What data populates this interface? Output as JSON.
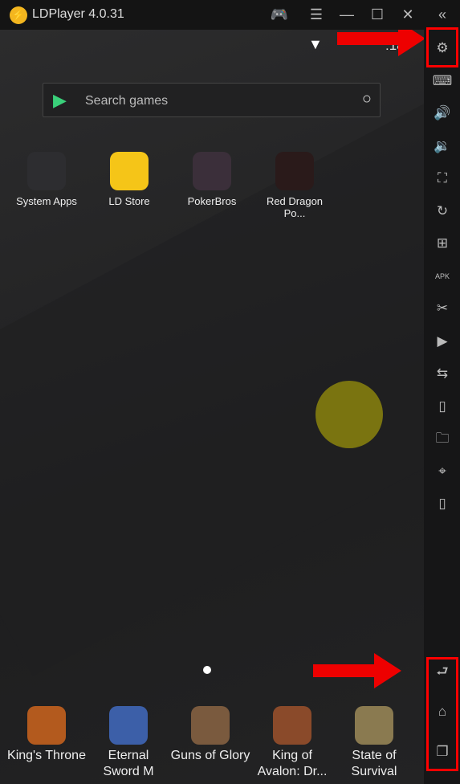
{
  "window": {
    "title": "LDPlayer 4.0.31",
    "controls": [
      "gamepad-icon",
      "menu-icon",
      "minimize-icon",
      "maximize-icon",
      "close-icon",
      "collapse-icon"
    ]
  },
  "status": {
    "time": ":18"
  },
  "search": {
    "placeholder": "Search games"
  },
  "apps": [
    {
      "label": "System Apps",
      "color": "#2d2d30"
    },
    {
      "label": "LD Store",
      "color": "#f5c518"
    },
    {
      "label": "PokerBros",
      "color": "#3b2f3a"
    },
    {
      "label": "Red Dragon Po...",
      "color": "#2a1a1a"
    }
  ],
  "dock": [
    {
      "label": "King's Throne",
      "color": "#b35a1e"
    },
    {
      "label": "Eternal Sword M",
      "color": "#3c5fa8"
    },
    {
      "label": "Guns of Glory",
      "color": "#7a5a3e"
    },
    {
      "label": "King of Avalon: Dr...",
      "color": "#8a4a2a"
    },
    {
      "label": "State of Survival",
      "color": "#8a7a50"
    }
  ],
  "sidebar": [
    "settings-icon",
    "keyboard-icon",
    "volume-up-icon",
    "volume-down-icon",
    "fullscreen-icon",
    "rotate-icon",
    "add-window-icon",
    "apk-icon",
    "scissors-icon",
    "video-icon",
    "sync-icon",
    "shake-icon",
    "folder-icon",
    "location-icon",
    "vibrate-icon"
  ],
  "sidebar_glyphs": [
    "⚙",
    "⌨",
    "🔊",
    "🔉",
    "⛶",
    "↻",
    "⊞",
    "APK",
    "✂",
    "▶",
    "⇆",
    "▯",
    "🗀",
    "⌖",
    "▯"
  ],
  "nav": {
    "back": "⮐",
    "home": "⌂",
    "recent": "❐"
  },
  "accent": "#ff0000"
}
